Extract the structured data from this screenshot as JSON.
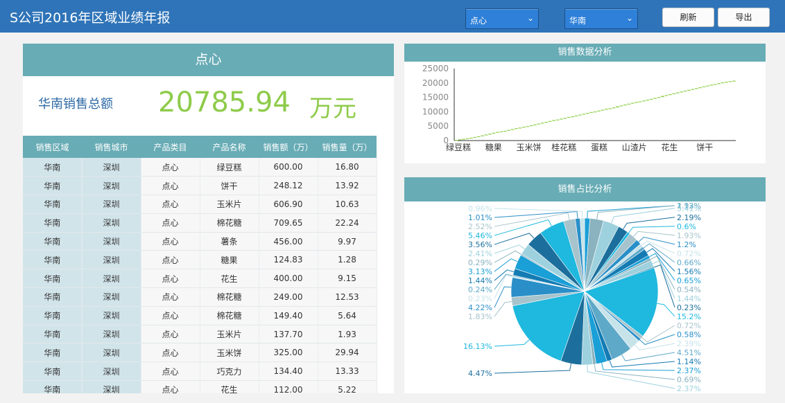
{
  "header": {
    "title": "S公司2016年区域业绩年报",
    "category_select": "点心",
    "region_select": "华南",
    "refresh_label": "刷新",
    "export_label": "导出"
  },
  "summary": {
    "category": "点心",
    "total_label": "华南销售总额",
    "total_value": "20785.94",
    "total_unit": "万元"
  },
  "table": {
    "columns": [
      "销售区域",
      "销售城市",
      "产品类目",
      "产品名称",
      "销售额（万）",
      "销售量（万）"
    ],
    "rows": [
      [
        "华南",
        "深圳",
        "点心",
        "绿豆糕",
        "600.00",
        "16.80"
      ],
      [
        "华南",
        "深圳",
        "点心",
        "饼干",
        "248.12",
        "13.92"
      ],
      [
        "华南",
        "深圳",
        "点心",
        "玉米片",
        "606.90",
        "10.63"
      ],
      [
        "华南",
        "深圳",
        "点心",
        "棉花糖",
        "709.65",
        "22.24"
      ],
      [
        "华南",
        "深圳",
        "点心",
        "薯条",
        "456.00",
        "9.97"
      ],
      [
        "华南",
        "深圳",
        "点心",
        "糖果",
        "124.83",
        "1.28"
      ],
      [
        "华南",
        "深圳",
        "点心",
        "花生",
        "400.00",
        "9.15"
      ],
      [
        "华南",
        "深圳",
        "点心",
        "棉花糖",
        "249.00",
        "12.53"
      ],
      [
        "华南",
        "深圳",
        "点心",
        "棉花糖",
        "149.40",
        "5.64"
      ],
      [
        "华南",
        "深圳",
        "点心",
        "玉米片",
        "137.70",
        "1.93"
      ],
      [
        "华南",
        "深圳",
        "点心",
        "玉米饼",
        "325.00",
        "29.94"
      ],
      [
        "华南",
        "深圳",
        "点心",
        "巧克力",
        "134.40",
        "13.33"
      ],
      [
        "华南",
        "深圳",
        "点心",
        "花生",
        "112.00",
        "5.22"
      ]
    ]
  },
  "colors": {
    "header_bg": "#2f74b8",
    "accent": "#68acb5",
    "value_green": "#8ecb4a",
    "label_blue": "#2e6aa6"
  },
  "chart_data": [
    {
      "type": "bar",
      "title": "销售数据分析",
      "ylim": [
        0,
        25000
      ],
      "yticks": [
        0,
        5000,
        10000,
        15000,
        20000,
        25000
      ],
      "categories": [
        "绿豆糕",
        "糖果",
        "玉米饼",
        "桂花糕",
        "蛋糕",
        "山渣片",
        "花生",
        "饼干"
      ],
      "base": [
        0,
        200,
        400,
        600,
        800,
        1000,
        1250,
        1500,
        1800,
        2100,
        2400,
        2700,
        3000,
        3200,
        3400,
        3700,
        4000,
        4300,
        4500,
        4800,
        5000,
        5300,
        5600,
        5900,
        6200,
        6500,
        6800,
        7100,
        7300,
        7600,
        7900,
        8200,
        8400,
        8700,
        9000,
        9300,
        9600,
        9900,
        10100,
        10400,
        10700,
        11000,
        11200,
        11500,
        11900,
        12200,
        12500,
        12800,
        13100,
        13400,
        13600,
        13900,
        14200,
        14500,
        14800,
        15100,
        15500,
        15800,
        16100,
        16400,
        16700,
        17000,
        17300,
        17600,
        17900,
        18200,
        18500,
        18800,
        19100,
        19400,
        19600,
        19900,
        20200,
        20400,
        20600
      ],
      "values": [
        200,
        200,
        200,
        200,
        200,
        250,
        250,
        300,
        300,
        300,
        300,
        300,
        200,
        200,
        300,
        300,
        300,
        200,
        300,
        200,
        300,
        300,
        300,
        300,
        300,
        300,
        300,
        200,
        300,
        300,
        300,
        200,
        300,
        300,
        300,
        300,
        300,
        200,
        300,
        300,
        300,
        200,
        300,
        400,
        300,
        300,
        300,
        300,
        300,
        200,
        300,
        300,
        300,
        300,
        300,
        400,
        300,
        300,
        300,
        300,
        300,
        300,
        300,
        300,
        300,
        300,
        300,
        300,
        300,
        200,
        300,
        300,
        200,
        200,
        186
      ]
    },
    {
      "type": "pie",
      "title": "销售占比分析",
      "slices": [
        {
          "label": "1.13%",
          "value": 1.13
        },
        {
          "label": "2.92%",
          "value": 2.92
        },
        {
          "label": "3.41%",
          "value": 3.41
        },
        {
          "label": "2.19%",
          "value": 2.19
        },
        {
          "label": "0.6%",
          "value": 0.6
        },
        {
          "label": "1.93%",
          "value": 1.93
        },
        {
          "label": "1.2%",
          "value": 1.2
        },
        {
          "label": "0.72%",
          "value": 0.72
        },
        {
          "label": "0.66%",
          "value": 0.66
        },
        {
          "label": "1.56%",
          "value": 1.56
        },
        {
          "label": "0.65%",
          "value": 0.65
        },
        {
          "label": "0.54%",
          "value": 0.54
        },
        {
          "label": "1.44%",
          "value": 1.44
        },
        {
          "label": "0.23%",
          "value": 0.23
        },
        {
          "label": "15.2%",
          "value": 15.2
        },
        {
          "label": "0.72%",
          "value": 0.72
        },
        {
          "label": "0.58%",
          "value": 0.58
        },
        {
          "label": "2.39%",
          "value": 2.39
        },
        {
          "label": "4.51%",
          "value": 4.51
        },
        {
          "label": "1.14%",
          "value": 1.14
        },
        {
          "label": "2.37%",
          "value": 2.37
        },
        {
          "label": "0.69%",
          "value": 0.69
        },
        {
          "label": "2.37%",
          "value": 2.37
        },
        {
          "label": "4.47%",
          "value": 4.47
        },
        {
          "label": "16.13%",
          "value": 16.13
        },
        {
          "label": "1.83%",
          "value": 1.83
        },
        {
          "label": "4.22%",
          "value": 4.22
        },
        {
          "label": "0.23%",
          "value": 0.23
        },
        {
          "label": "0.24%",
          "value": 0.24
        },
        {
          "label": "1.44%",
          "value": 1.44
        },
        {
          "label": "3.13%",
          "value": 3.13
        },
        {
          "label": "0.29%",
          "value": 0.29
        },
        {
          "label": "2.41%",
          "value": 2.41
        },
        {
          "label": "3.56%",
          "value": 3.56
        },
        {
          "label": "5.46%",
          "value": 5.46
        },
        {
          "label": "2.52%",
          "value": 2.52
        },
        {
          "label": "1.01%",
          "value": 1.01
        },
        {
          "label": "0.96%",
          "value": 0.96
        }
      ]
    }
  ]
}
